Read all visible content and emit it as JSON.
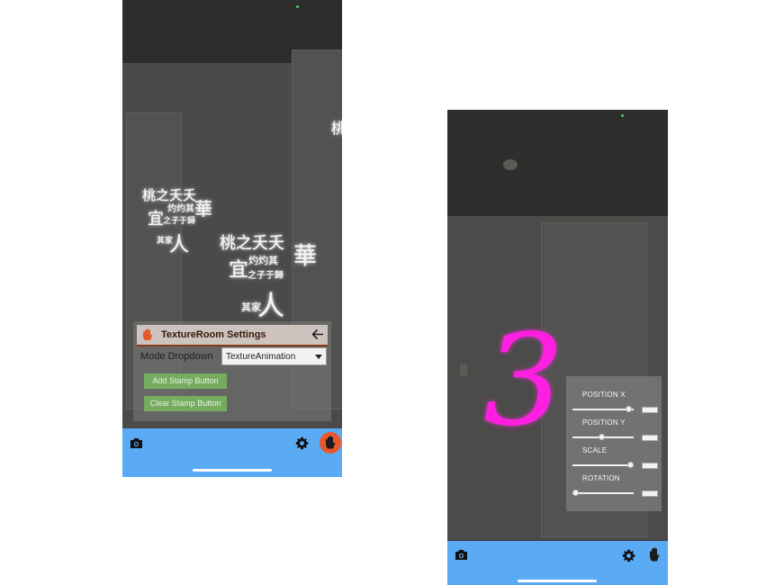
{
  "left_screen": {
    "stamp_rows": [
      [
        "桃之夭夭",
        "灼灼其",
        "華"
      ],
      [
        "宜",
        "之子于歸",
        "其家",
        "人"
      ]
    ],
    "settings_panel": {
      "title": "TextureRoom Settings",
      "mode_label": "Mode Dropdown",
      "mode_value": "TextureAnimation",
      "add_stamp_label": "Add Stamp Button",
      "clear_stamp_label": "Clear Stamp Button"
    },
    "bottom_bar": {
      "camera_icon": "camera-icon",
      "settings_icon": "gear-icon",
      "hand_icon": "hand-icon"
    }
  },
  "right_screen": {
    "overlay_number": "3",
    "overlay_color": "#ff1fe0",
    "transform_panel": {
      "sliders": [
        {
          "label": "POSITION X",
          "value": 0.92
        },
        {
          "label": "POSITION Y",
          "value": 0.48
        },
        {
          "label": "SCALE",
          "value": 0.95
        },
        {
          "label": "ROTATION",
          "value": 0.05
        }
      ]
    },
    "bottom_bar": {
      "camera_icon": "camera-icon",
      "settings_icon": "gear-icon",
      "hand_icon": "hand-icon"
    }
  },
  "colors": {
    "bottom_bar": "#5aaaf4",
    "accent_orange": "#e8582a",
    "button_green": "#78b95f"
  }
}
